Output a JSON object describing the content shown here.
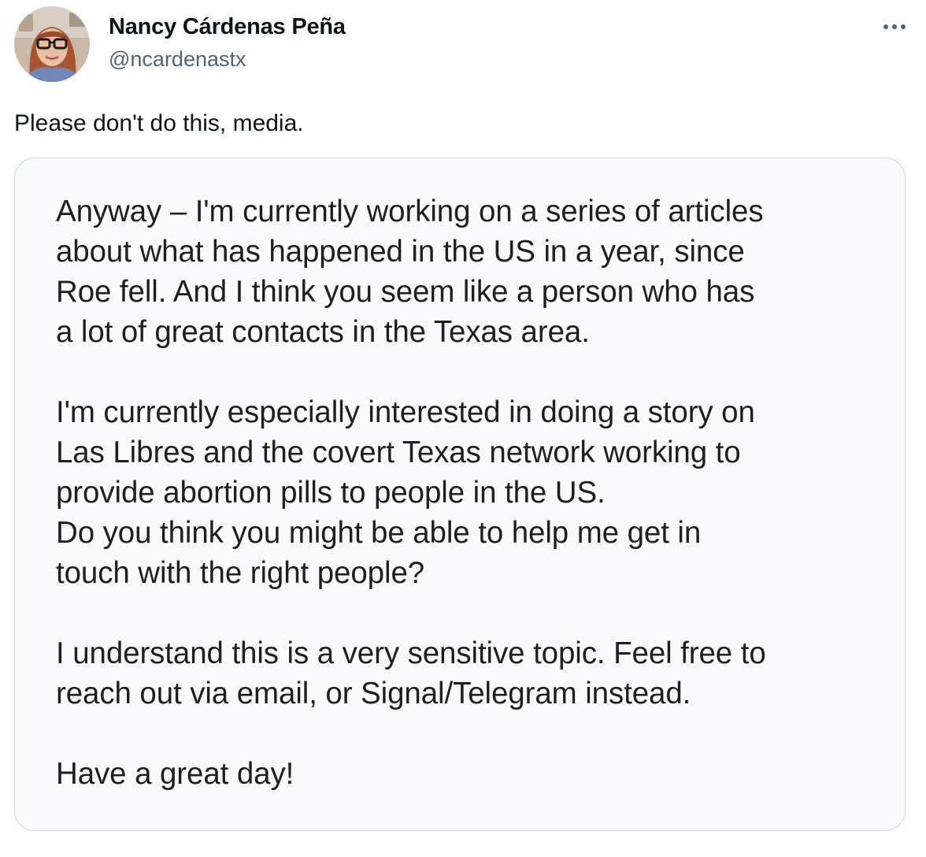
{
  "author": {
    "display_name": "Nancy Cárdenas Peña",
    "handle": "@ncardenastx",
    "avatar_icon": "profile-photo"
  },
  "more_icon": "more-horizontal-icon",
  "tweet": {
    "text": "Please don't do this, media."
  },
  "media": {
    "paragraphs": [
      {
        "lines": [
          "Anyway – I'm currently working on a series of articles",
          "about what has happened in the US in a year, since",
          "Roe fell. And I think you seem like a person who has",
          "a lot of great contacts in the Texas area."
        ]
      },
      {
        "lines": [
          "I'm currently especially interested in doing a story on",
          "Las Libres and the covert Texas network working to",
          "provide abortion pills to people in the US.",
          "Do you think you might be able to help me get in",
          "touch with the right people?"
        ]
      },
      {
        "lines": [
          "I understand this is a very sensitive topic. Feel free to",
          "reach out via email, or Signal/Telegram instead."
        ]
      },
      {
        "lines": [
          "Have a great day!"
        ]
      }
    ]
  },
  "colors": {
    "text_primary": "#0f1419",
    "text_secondary": "#536471",
    "card_border": "#cfd9de",
    "card_background": "#fafafc"
  }
}
